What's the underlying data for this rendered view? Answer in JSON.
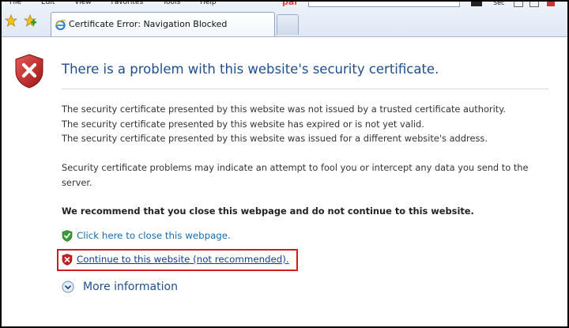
{
  "menubar": {
    "items": [
      "File",
      "Edit",
      "View",
      "Favorites",
      "Tools",
      "Help"
    ],
    "brand_text": "pal",
    "tool_label": "Sec"
  },
  "tab": {
    "title": "Certificate Error: Navigation Blocked"
  },
  "page": {
    "title": "There is a problem with this website's security certificate.",
    "reasons": [
      "The security certificate presented by this website was not issued by a trusted certificate authority.",
      "The security certificate presented by this website has expired or is not yet valid.",
      "The security certificate presented by this website was issued for a different website's address."
    ],
    "warning": [
      "Security certificate problems may indicate an attempt to fool you or intercept any data you send to the",
      "server."
    ],
    "recommendation": "We recommend that you close this webpage and do not continue to this website.",
    "close_link": "Click here to close this webpage.",
    "continue_link": "Continue to this website (not recommended).",
    "more_info": "More information"
  },
  "colors": {
    "title": "#1f4e8c",
    "link": "#1a6aa7",
    "highlight": "#d01c1c",
    "shield_red": "#c62020",
    "shield_green": "#3a9a3a"
  }
}
